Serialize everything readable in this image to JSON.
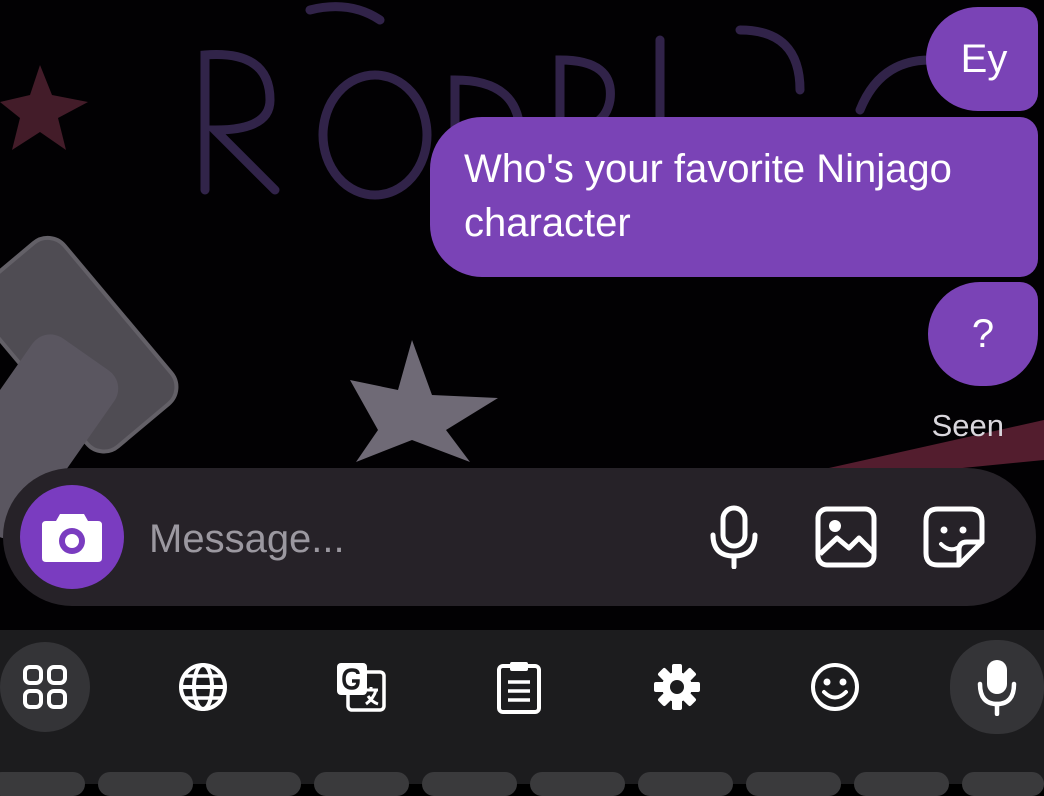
{
  "messages": [
    {
      "text": "Ey"
    },
    {
      "text": "Who's your favorite Ninjago character"
    },
    {
      "text": "?"
    }
  ],
  "status": {
    "seen": "Seen"
  },
  "composer": {
    "placeholder": "Message..."
  },
  "keyboard_toolbar": [
    "apps-grid-icon",
    "globe-icon",
    "translate-icon",
    "clipboard-icon",
    "gear-icon",
    "emoji-icon",
    "microphone-icon"
  ],
  "colors": {
    "bubble": "#7a43b6",
    "camera_button": "#7a3cc0",
    "composer_bg": "#262228",
    "keyboard_bg": "#1c1c1e"
  }
}
